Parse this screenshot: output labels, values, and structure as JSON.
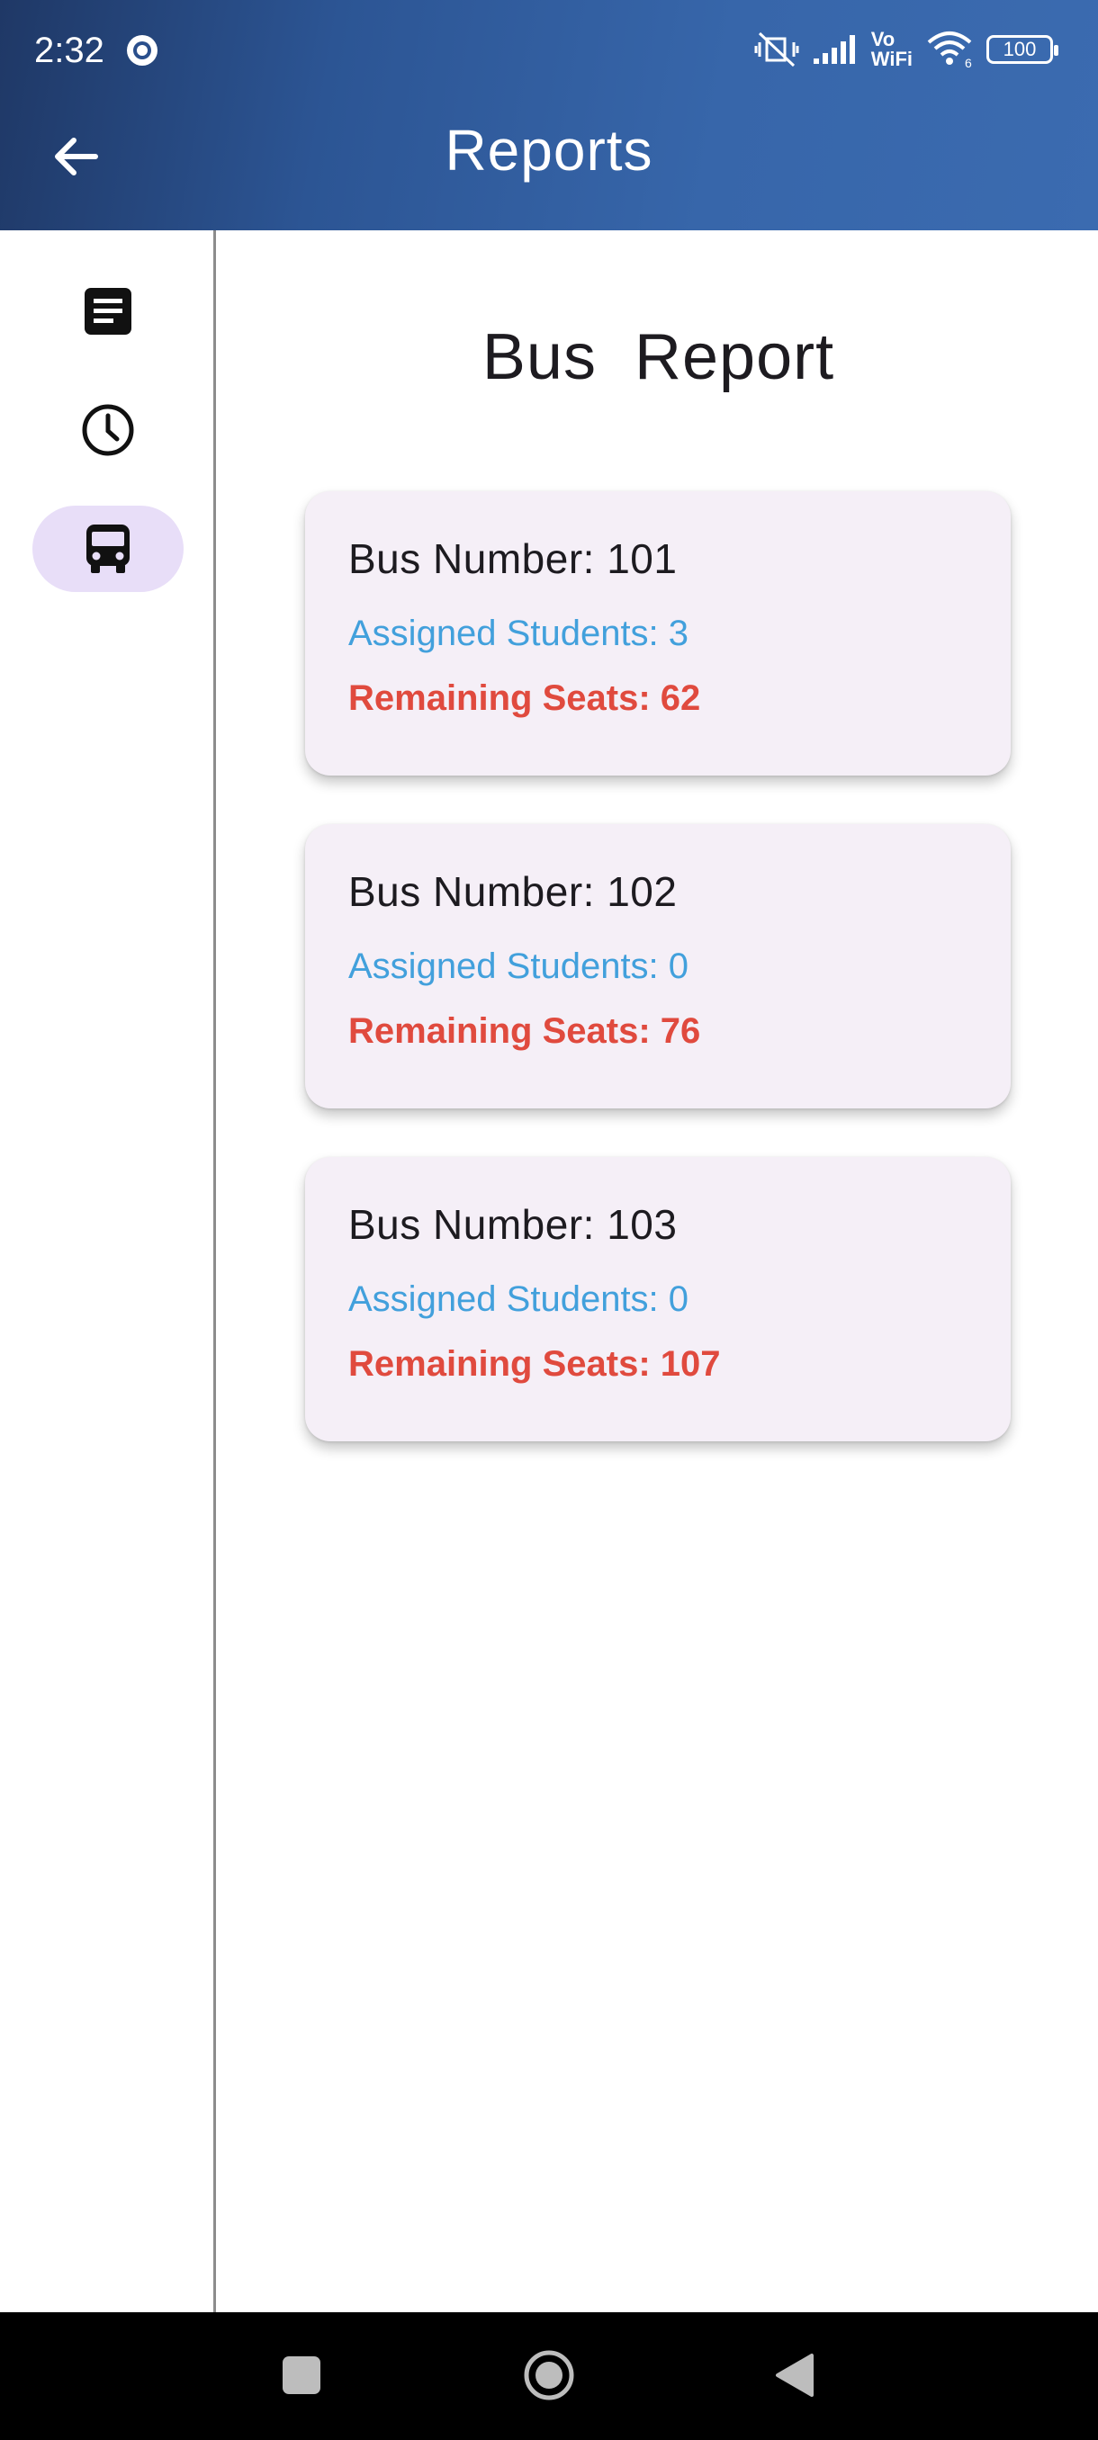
{
  "status_bar": {
    "time": "2:32",
    "network_label_top": "Vo",
    "network_label_bottom": "WiFi",
    "wifi_badge": "6",
    "battery": "100"
  },
  "app_bar": {
    "title": "Reports",
    "back_icon": "arrow-back-icon"
  },
  "rail": {
    "items": [
      {
        "icon": "article-icon",
        "active": false
      },
      {
        "icon": "clock-icon",
        "active": false
      },
      {
        "icon": "bus-icon",
        "active": true
      }
    ]
  },
  "main": {
    "title": "Bus  Report",
    "buses": [
      {
        "title": "Bus Number: 101",
        "assigned": "Assigned Students: 3",
        "remaining": "Remaining Seats: 62"
      },
      {
        "title": "Bus Number: 102",
        "assigned": "Assigned Students: 0",
        "remaining": "Remaining Seats: 76"
      },
      {
        "title": "Bus Number: 103",
        "assigned": "Assigned Students: 0",
        "remaining": "Remaining Seats: 107"
      }
    ]
  },
  "colors": {
    "app_bar_start": "#1f3866",
    "app_bar_end": "#3b6bb0",
    "active_rail": "#e8def8",
    "card_bg": "#f5eff7",
    "assigned_text": "#42a0dc",
    "remaining_text": "#e04a3e"
  },
  "system_nav": {
    "icons": [
      "recents-square-icon",
      "home-circle-icon",
      "back-triangle-icon"
    ]
  }
}
